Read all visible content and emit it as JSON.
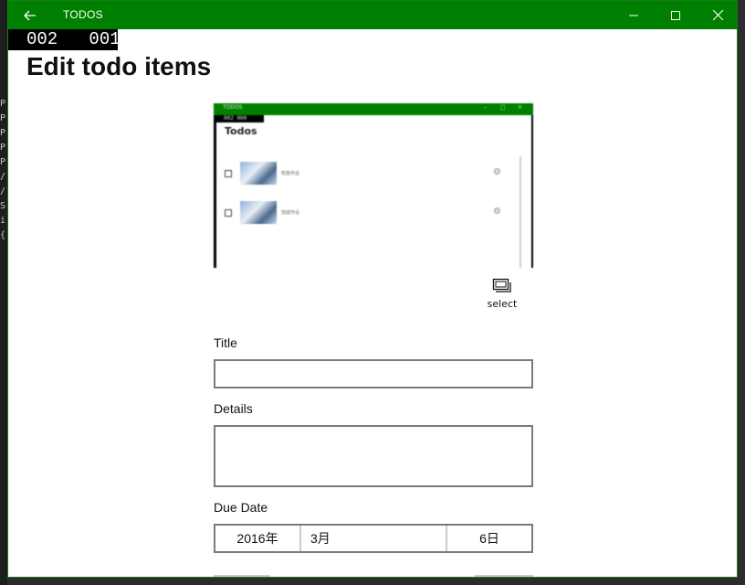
{
  "window": {
    "title": "TODOS",
    "title_color": "#008000"
  },
  "frame_counter": "002   001",
  "page": {
    "title": "Edit todo items"
  },
  "preview": {
    "heading": "Todos",
    "counter": "002  000",
    "items": [
      {
        "text": "吃饭作业"
      },
      {
        "text": "完成作业"
      }
    ]
  },
  "select_button": {
    "label": "select",
    "icon": "select-icon"
  },
  "form": {
    "title_label": "Title",
    "title_value": "",
    "details_label": "Details",
    "details_value": "",
    "due_date_label": "Due Date",
    "due_date": {
      "year": "2016年",
      "month": "3月",
      "day": "6日"
    }
  },
  "background_code": [
    "P",
    "P",
    "P",
    "P",
    "P",
    "/",
    "/",
    "S",
    "i",
    "{"
  ]
}
